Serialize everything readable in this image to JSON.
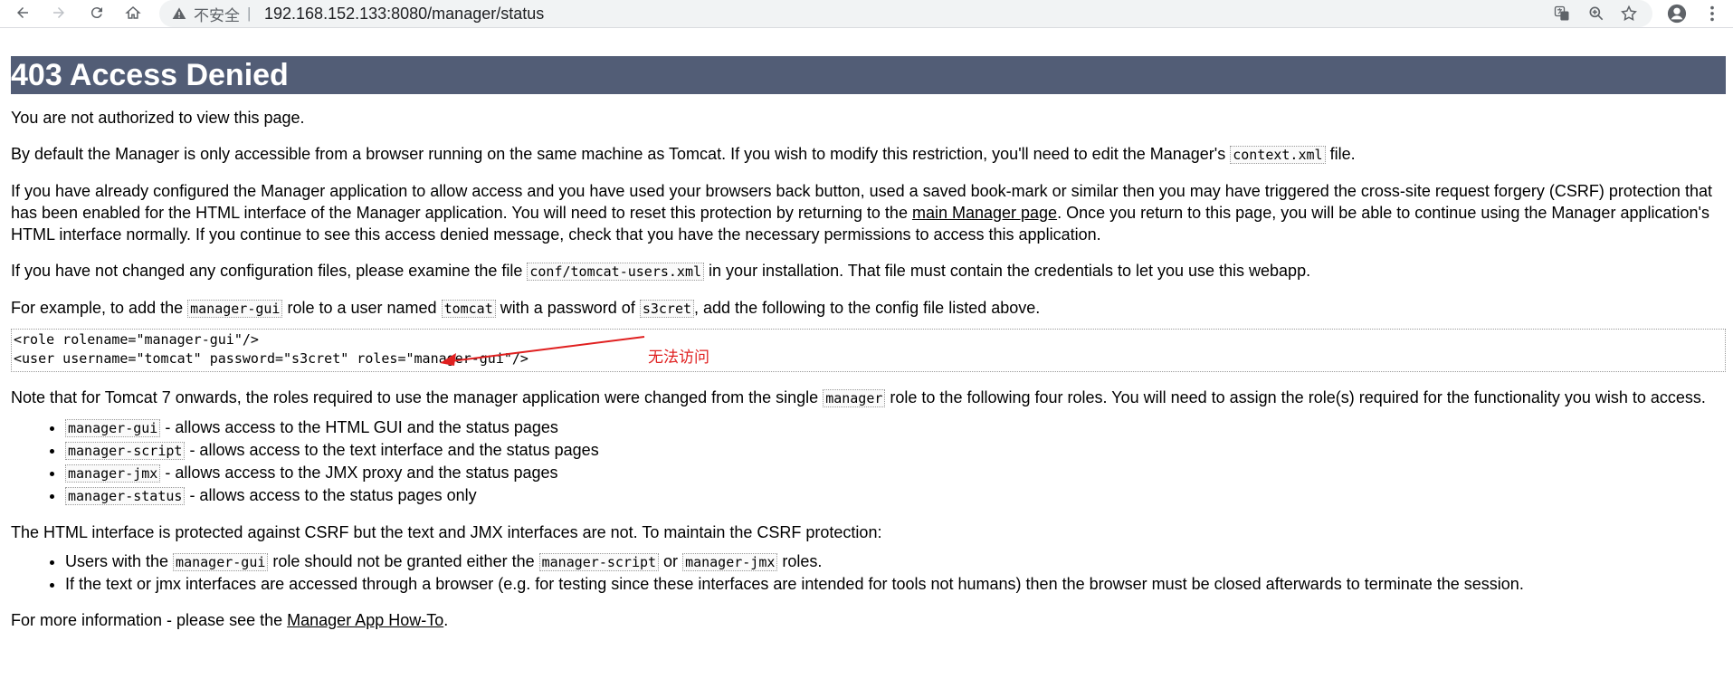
{
  "browser": {
    "security_label": "不安全",
    "url": "192.168.152.133:8080/manager/status"
  },
  "page": {
    "title": "403 Access Denied",
    "p1": "You are not authorized to view this page.",
    "p2": {
      "before": "By default the Manager is only accessible from a browser running on the same machine as Tomcat. If you wish to modify this restriction, you'll need to edit the Manager's ",
      "code": "context.xml",
      "after": " file."
    },
    "p3": {
      "before": "If you have already configured the Manager application to allow access and you have used your browsers back button, used a saved book-mark or similar then you may have triggered the cross-site request forgery (CSRF) protection that has been enabled for the HTML interface of the Manager application. You will need to reset this protection by returning to the ",
      "link": "main Manager page",
      "after": ". Once you return to this page, you will be able to continue using the Manager application's HTML interface normally. If you continue to see this access denied message, check that you have the necessary permissions to access this application."
    },
    "p4": {
      "before": "If you have not changed any configuration files, please examine the file ",
      "code": "conf/tomcat-users.xml",
      "after": " in your installation. That file must contain the credentials to let you use this webapp."
    },
    "p5": {
      "t1": "For example, to add the ",
      "c1": "manager-gui",
      "t2": " role to a user named ",
      "c2": "tomcat",
      "t3": " with a password of ",
      "c3": "s3cret",
      "t4": ", add the following to the config file listed above."
    },
    "example_line1": "<role rolename=\"manager-gui\"/>",
    "example_line2": "<user username=\"tomcat\" password=\"s3cret\" roles=\"manager-gui\"/>",
    "annotation": "无法访问",
    "p6": {
      "before": "Note that for Tomcat 7 onwards, the roles required to use the manager application were changed from the single ",
      "code": "manager",
      "after": " role to the following four roles. You will need to assign the role(s) required for the functionality you wish to access."
    },
    "roles": [
      {
        "code": "manager-gui",
        "text": " - allows access to the HTML GUI and the status pages"
      },
      {
        "code": "manager-script",
        "text": " - allows access to the text interface and the status pages"
      },
      {
        "code": "manager-jmx",
        "text": " - allows access to the JMX proxy and the status pages"
      },
      {
        "code": "manager-status",
        "text": " - allows access to the status pages only"
      }
    ],
    "p7": "The HTML interface is protected against CSRF but the text and JMX interfaces are not. To maintain the CSRF protection:",
    "csrf1": {
      "t1": "Users with the ",
      "c1": "manager-gui",
      "t2": " role should not be granted either the ",
      "c2": "manager-script",
      "t3": " or ",
      "c3": "manager-jmx",
      "t4": " roles."
    },
    "csrf2": "If the text or jmx interfaces are accessed through a browser (e.g. for testing since these interfaces are intended for tools not humans) then the browser must be closed afterwards to terminate the session.",
    "p8": {
      "before": "For more information - please see the ",
      "link": "Manager App How-To",
      "after": "."
    }
  }
}
